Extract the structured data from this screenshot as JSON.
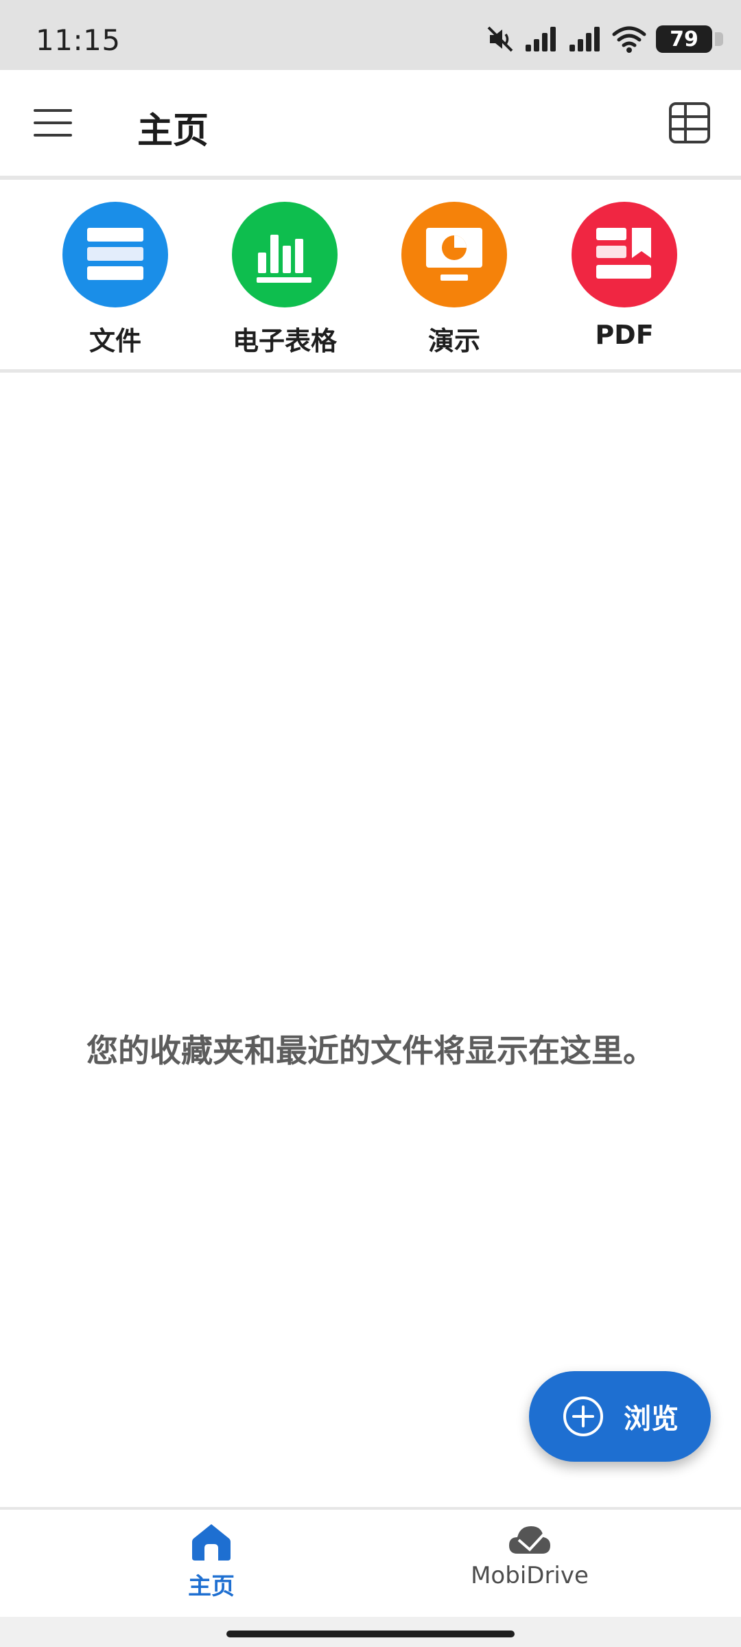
{
  "status_bar": {
    "time": "11:15",
    "battery": "79",
    "icons": [
      "mute-icon",
      "signal-icon",
      "signal-icon",
      "wifi-icon",
      "battery-icon"
    ]
  },
  "app_bar": {
    "title": "主页",
    "menu_icon": "hamburger-menu-icon",
    "view_icon": "grid-view-icon"
  },
  "quick_create": [
    {
      "label": "文件",
      "icon": "document-icon",
      "color": "#1a8ee8"
    },
    {
      "label": "电子表格",
      "icon": "spreadsheet-icon",
      "color": "#0ebe4e"
    },
    {
      "label": "演示",
      "icon": "presentation-icon",
      "color": "#f5820a"
    },
    {
      "label": "PDF",
      "icon": "pdf-icon",
      "color": "#f02642"
    }
  ],
  "empty_state": {
    "message": "您的收藏夹和最近的文件将显示在这里。"
  },
  "fab": {
    "label": "浏览",
    "icon": "plus-circle-icon",
    "color": "#1e6fd1"
  },
  "bottom_nav": {
    "items": [
      {
        "label": "主页",
        "icon": "home-icon",
        "active": true
      },
      {
        "label": "MobiDrive",
        "icon": "cloud-icon",
        "active": false
      }
    ]
  }
}
